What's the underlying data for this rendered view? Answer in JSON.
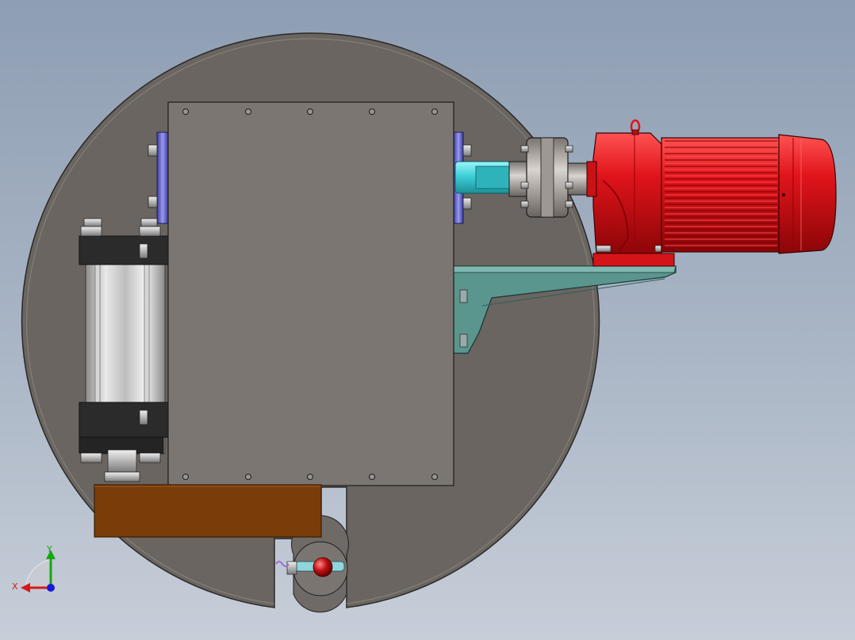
{
  "viewport": {
    "background_top": "#8e9eb3",
    "background_bottom": "#c7ced8"
  },
  "model": {
    "parts": [
      "base-disc",
      "main-housing-plate",
      "pneumatic-cylinder",
      "bearing-flange-left",
      "bearing-flange-right",
      "drive-shaft",
      "shaft-coupling",
      "gear-reducer",
      "electric-motor",
      "motor-mount-bracket",
      "wooden-block",
      "ball-joint-assembly"
    ],
    "colors": {
      "disc": "#6a6560",
      "plate": "#7b7672",
      "motor_red": "#e0141a",
      "bracket_teal": "#5a958e",
      "shaft_cyan": "#3fd0d8",
      "wood": "#7a3d0a",
      "flange_blue": "#6a6ad8"
    }
  },
  "triad": {
    "x_label": "X",
    "y_label": "Y",
    "x_color": "#d81818",
    "y_color": "#14a814",
    "z_color": "#1818d8"
  }
}
